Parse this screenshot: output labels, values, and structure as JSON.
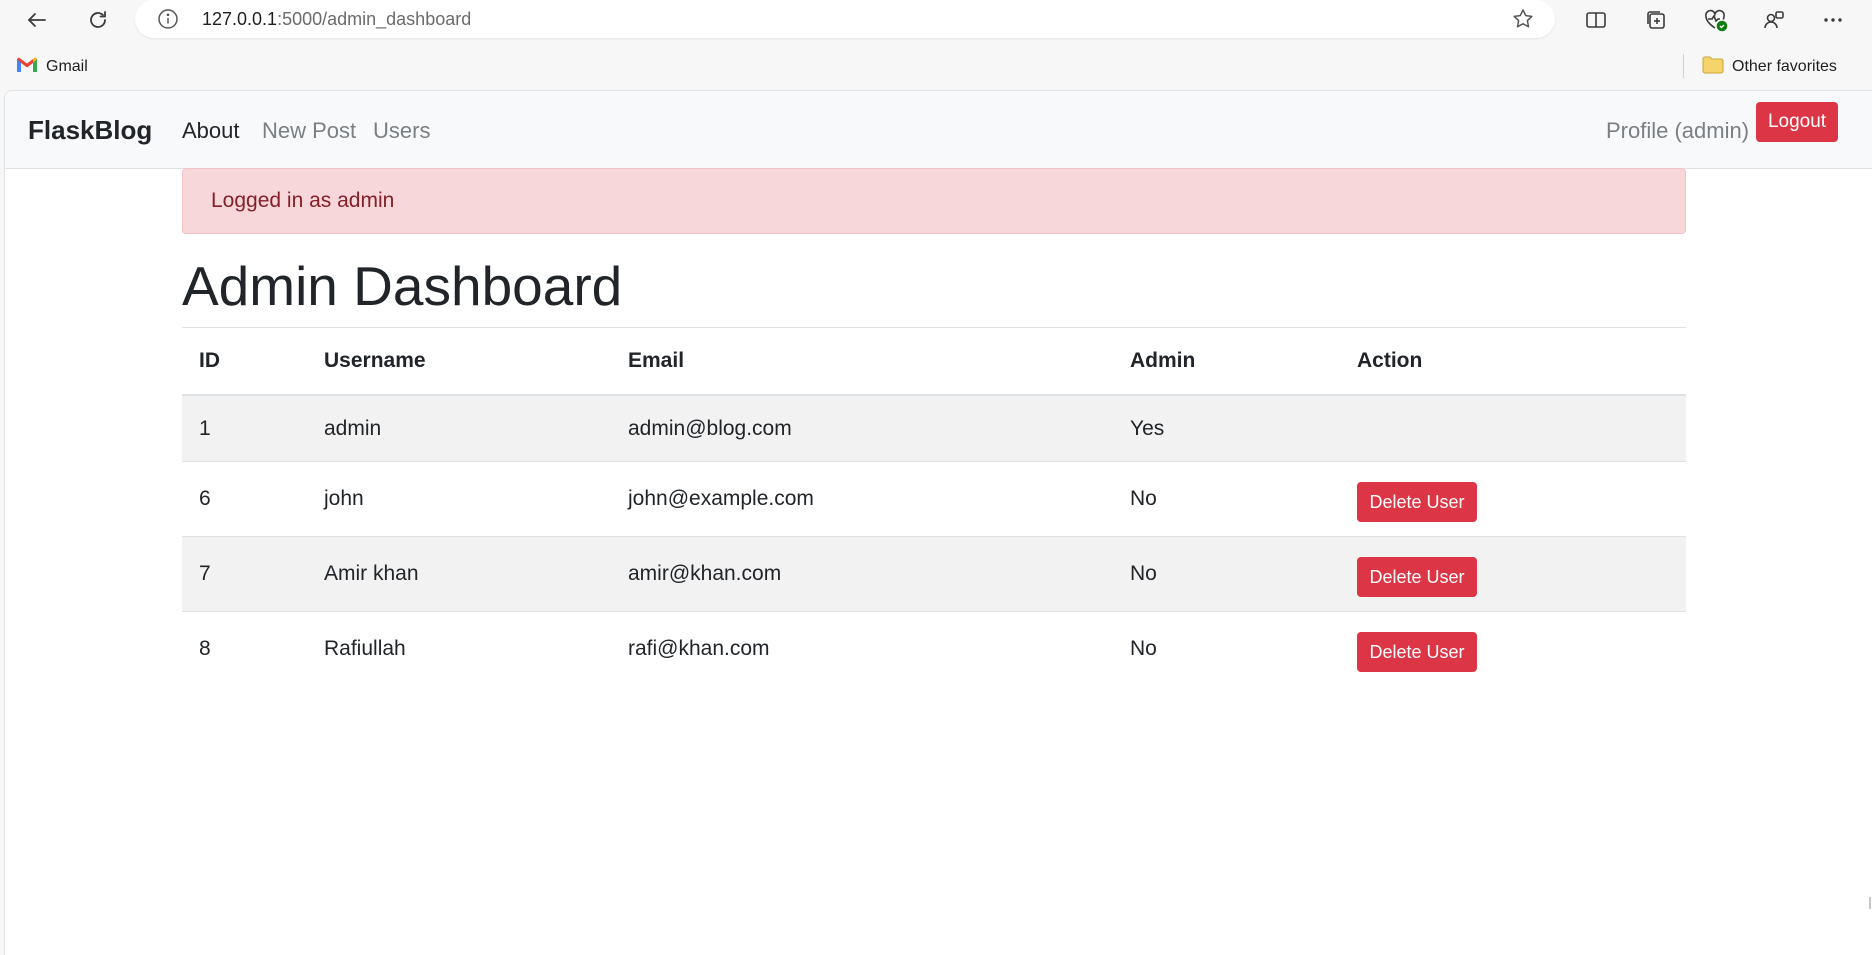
{
  "browser": {
    "url_host": "127.0.0.1",
    "url_path": ":5000/admin_dashboard",
    "favorites": [
      {
        "label": "Gmail",
        "icon": "gmail-icon"
      },
      {
        "label": "Other favorites",
        "icon": "folder-icon"
      }
    ]
  },
  "navbar": {
    "brand": "FlaskBlog",
    "links": [
      "About",
      "New Post",
      "Users"
    ],
    "profile": "Profile (admin)",
    "logout": "Logout"
  },
  "alert": {
    "message": "Logged in as admin"
  },
  "main": {
    "title": "Admin Dashboard",
    "table": {
      "headers": [
        "ID",
        "Username",
        "Email",
        "Admin",
        "Action"
      ],
      "rows": [
        {
          "id": "1",
          "username": "admin",
          "email": "admin@blog.com",
          "admin": "Yes",
          "action": ""
        },
        {
          "id": "6",
          "username": "john",
          "email": "john@example.com",
          "admin": "No",
          "action": "Delete User"
        },
        {
          "id": "7",
          "username": "Amir khan",
          "email": "amir@khan.com",
          "admin": "No",
          "action": "Delete User"
        },
        {
          "id": "8",
          "username": "Rafiullah",
          "email": "rafi@khan.com",
          "admin": "No",
          "action": "Delete User"
        }
      ]
    }
  },
  "colors": {
    "danger": "#dc3545",
    "alert_bg": "#f8d7da",
    "alert_text": "#842029",
    "navbar_bg": "#f8f9fa",
    "stripe": "#f2f2f2"
  }
}
